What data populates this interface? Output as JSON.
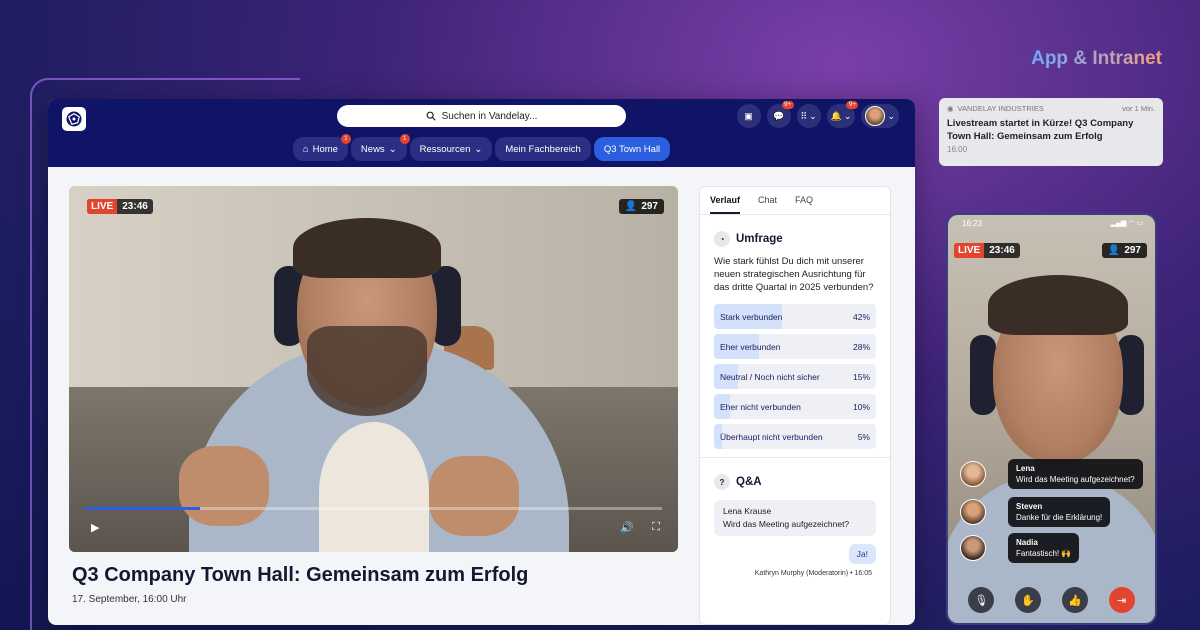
{
  "promo": {
    "title": "App & Intranet"
  },
  "header": {
    "search_placeholder": "Suchen in Vandelay...",
    "icons": [
      "contacts-icon",
      "chat-icon",
      "apps-grid-icon",
      "bell-icon",
      "avatar"
    ],
    "badges": {
      "chat": "9+",
      "notifications": "9+"
    }
  },
  "nav": {
    "items": [
      {
        "label": "Home",
        "badge": "1"
      },
      {
        "label": "News",
        "badge": "1"
      },
      {
        "label": "Ressourcen"
      },
      {
        "label": "Mein Fachbereich"
      },
      {
        "label": "Q3 Town Hall",
        "active": true
      }
    ]
  },
  "video": {
    "live_label": "LIVE",
    "time": "23:46",
    "viewers": "297",
    "progress": 0.2
  },
  "event": {
    "title": "Q3 Company Town Hall: Gemeinsam zum Erfolg",
    "date": "17. September, 16:00 Uhr"
  },
  "side_panel": {
    "tabs": [
      "Verlauf",
      "Chat",
      "FAQ"
    ],
    "poll": {
      "heading": "Umfrage",
      "question": "Wie stark fühlst Du dich mit unserer neuen strategischen Ausrichtung für das dritte Quartal in 2025 verbunden?",
      "options": [
        {
          "label": "Stark verbunden",
          "pct": "42%",
          "value": 42
        },
        {
          "label": "Eher verbunden",
          "pct": "28%",
          "value": 28
        },
        {
          "label": "Neutral / Noch nicht sicher",
          "pct": "15%",
          "value": 15
        },
        {
          "label": "Eher nicht verbunden",
          "pct": "10%",
          "value": 10
        },
        {
          "label": "Überhaupt nicht verbunden",
          "pct": "5%",
          "value": 5
        }
      ]
    },
    "qa": {
      "heading": "Q&A",
      "question_author": "Lena Krause",
      "question_text": "Wird das Meeting aufgezeichnet?",
      "answer": "Ja!",
      "answer_meta": "Kathryn Murphy (Moderatorin) • 16:05"
    }
  },
  "notification": {
    "source": "VANDELAY INDUSTRIES",
    "age": "vor 1 Min.",
    "text": "Livestream startet in Kürze! Q3 Company Town Hall: Gemeinsam zum Erfolg",
    "time": "16:00"
  },
  "phone": {
    "status_time": "16:23",
    "live_label": "LIVE",
    "time": "23:46",
    "viewers": "297",
    "chat": [
      {
        "name": "Lena",
        "text": "Wird das Meeting aufgezeichnet?"
      },
      {
        "name": "Steven",
        "text": "Danke für die Erklärung!"
      },
      {
        "name": "Nadia",
        "text": "Fantastisch! 🙌"
      }
    ],
    "controls": [
      "mic-off-icon",
      "raise-hand-icon",
      "thumbs-up-icon",
      "leave-icon"
    ]
  },
  "colors": {
    "navy": "#0f1466",
    "accent_blue": "#2b5fe0",
    "live_red": "#e2452f"
  }
}
